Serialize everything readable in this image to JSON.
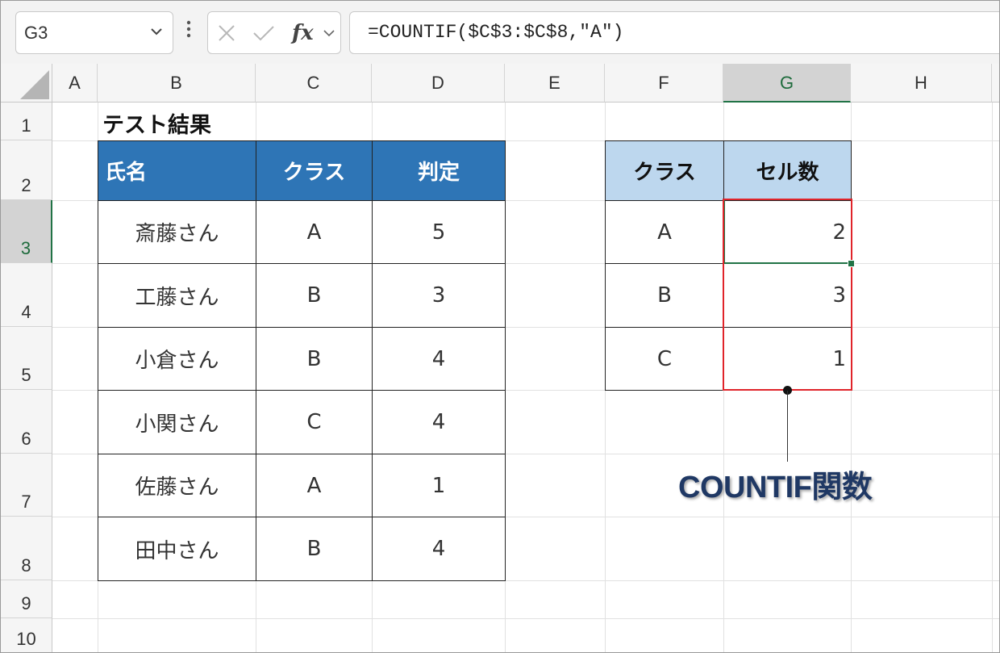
{
  "formula_bar": {
    "name_box": "G3",
    "formula": "=COUNTIF($C$3:$C$8,\"A\")"
  },
  "columns": [
    "A",
    "B",
    "C",
    "D",
    "E",
    "F",
    "G",
    "H"
  ],
  "rows": [
    "1",
    "2",
    "3",
    "4",
    "5",
    "6",
    "7",
    "8",
    "9",
    "10"
  ],
  "title": "テスト結果",
  "main_table": {
    "headers": [
      "氏名",
      "クラス",
      "判定"
    ],
    "rows": [
      [
        "斎藤さん",
        "A",
        "5"
      ],
      [
        "工藤さん",
        "B",
        "3"
      ],
      [
        "小倉さん",
        "B",
        "4"
      ],
      [
        "小関さん",
        "C",
        "4"
      ],
      [
        "佐藤さん",
        "A",
        "1"
      ],
      [
        "田中さん",
        "B",
        "4"
      ]
    ]
  },
  "count_table": {
    "headers": [
      "クラス",
      "セル数"
    ],
    "rows": [
      [
        "A",
        "2"
      ],
      [
        "B",
        "3"
      ],
      [
        "C",
        "1"
      ]
    ]
  },
  "callout": "COUNTIF関数",
  "colors": {
    "header_blue": "#2e75b6",
    "header_light": "#bdd7ee",
    "highlight_red": "#e0242a",
    "excel_green": "#217346",
    "callout_navy": "#1f3864"
  }
}
